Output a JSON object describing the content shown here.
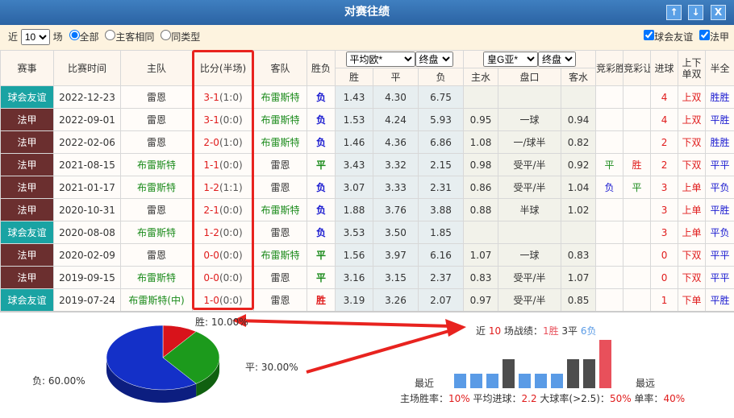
{
  "title": "对赛往绩",
  "buttons": {
    "up": "↑",
    "down": "↓",
    "close": "X"
  },
  "filter": {
    "near": "近",
    "count": "10",
    "unit": "场",
    "opt_all": "全部",
    "opt_same": "主客相同",
    "opt_type": "同类型",
    "chk_friendly": "球会友谊",
    "chk_ligue1": "法甲"
  },
  "headers": {
    "league": "赛事",
    "time": "比赛时间",
    "home": "主队",
    "score": "比分(半场)",
    "away": "客队",
    "result": "胜负",
    "euro_company": "平均欧*",
    "euro_type": "终盘",
    "asia_company": "皇G亚*",
    "asia_type": "终盘",
    "win": "胜",
    "draw": "平",
    "lose": "负",
    "hw": "主水",
    "hc": "盘口",
    "aw": "客水",
    "jc_result": "竞彩胜负",
    "jc_hcp": "竞彩让球",
    "goals": "进球",
    "ou": "上下单双",
    "hf": "半全"
  },
  "colors": {
    "friendly": "#1aa3a3",
    "ligue1": "#6b2f2f",
    "win": "#e8505b",
    "draw": "#4d4d4d",
    "lose": "#5a9be6"
  },
  "rows": [
    [
      "球会友谊",
      "2022-12-23",
      "雷恩",
      "3-1",
      "(1:0)",
      "布雷斯特",
      "负",
      "1.43",
      "4.30",
      "6.75",
      "",
      "",
      "",
      "",
      "",
      "4",
      "上双",
      "胜胜"
    ],
    [
      "法甲",
      "2022-09-01",
      "雷恩",
      "3-1",
      "(0:0)",
      "布雷斯特",
      "负",
      "1.53",
      "4.24",
      "5.93",
      "0.95",
      "一球",
      "0.94",
      "",
      "",
      "4",
      "上双",
      "平胜"
    ],
    [
      "法甲",
      "2022-02-06",
      "雷恩",
      "2-0",
      "(1:0)",
      "布雷斯特",
      "负",
      "1.46",
      "4.36",
      "6.86",
      "1.08",
      "一/球半",
      "0.82",
      "",
      "",
      "2",
      "下双",
      "胜胜"
    ],
    [
      "法甲",
      "2021-08-15",
      "布雷斯特",
      "1-1",
      "(0:0)",
      "雷恩",
      "平",
      "3.43",
      "3.32",
      "2.15",
      "0.98",
      "受平/半",
      "0.92",
      "平",
      "胜",
      "2",
      "下双",
      "平平"
    ],
    [
      "法甲",
      "2021-01-17",
      "布雷斯特",
      "1-2",
      "(1:1)",
      "雷恩",
      "负",
      "3.07",
      "3.33",
      "2.31",
      "0.86",
      "受平/半",
      "1.04",
      "负",
      "平",
      "3",
      "上单",
      "平负"
    ],
    [
      "法甲",
      "2020-10-31",
      "雷恩",
      "2-1",
      "(0:0)",
      "布雷斯特",
      "负",
      "1.88",
      "3.76",
      "3.88",
      "0.88",
      "半球",
      "1.02",
      "",
      "",
      "3",
      "上单",
      "平胜"
    ],
    [
      "球会友谊",
      "2020-08-08",
      "布雷斯特",
      "1-2",
      "(0:0)",
      "雷恩",
      "负",
      "3.53",
      "3.50",
      "1.85",
      "",
      "",
      "",
      "",
      "",
      "3",
      "上单",
      "平负"
    ],
    [
      "法甲",
      "2020-02-09",
      "雷恩",
      "0-0",
      "(0:0)",
      "布雷斯特",
      "平",
      "1.56",
      "3.97",
      "6.16",
      "1.07",
      "一球",
      "0.83",
      "",
      "",
      "0",
      "下双",
      "平平"
    ],
    [
      "法甲",
      "2019-09-15",
      "布雷斯特",
      "0-0",
      "(0:0)",
      "雷恩",
      "平",
      "3.16",
      "3.15",
      "2.37",
      "0.83",
      "受平/半",
      "1.07",
      "",
      "",
      "0",
      "下双",
      "平平"
    ],
    [
      "球会友谊",
      "2019-07-24",
      "布雷斯特(中)",
      "1-0",
      "(0:0)",
      "雷恩",
      "胜",
      "3.19",
      "3.26",
      "2.07",
      "0.97",
      "受平/半",
      "0.85",
      "",
      "",
      "1",
      "下单",
      "平胜"
    ]
  ],
  "pie": {
    "win_label": "胜: 10.00%",
    "draw_label": "平: 30.00%",
    "lose_label": "负: 60.00%",
    "win": 10,
    "draw": 30,
    "lose": 60
  },
  "summary": {
    "p1": "近 ",
    "n": "10",
    "p2": " 场战绩：",
    "w": "1胜",
    "d": " 3平 ",
    "l": "6负"
  },
  "bars": {
    "recent": "最近",
    "far": "最远",
    "sequence": [
      "负",
      "负",
      "负",
      "平",
      "负",
      "负",
      "负",
      "平",
      "平",
      "胜"
    ]
  },
  "stats": {
    "home_win_label": "主场胜率：",
    "home_win": "10%",
    "avg_label": " 平均进球：",
    "avg": "2.2",
    "big_label": " 大球率(>2.5)：",
    "big": "50%",
    "odd_label": " 单率：",
    "odd": "40%"
  }
}
